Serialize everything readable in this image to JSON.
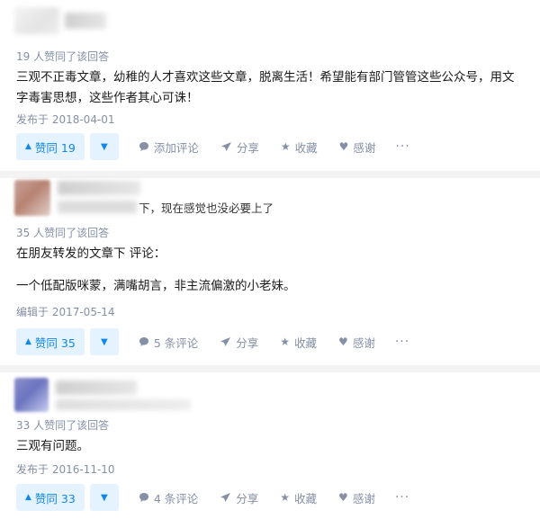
{
  "answers": [
    {
      "author_bio": "",
      "votes_text": "19 人赞同了该回答",
      "content": [
        "三观不正毒文章，幼稚的人才喜欢这些文章，脱离生活！希望能有部门管管这些公众号，用文字毒害思想，这些作者其心可诛！"
      ],
      "date": "发布于 2018-04-01",
      "vote_label": "赞同 19",
      "comment_label": "添加评论",
      "share_label": "分享",
      "collect_label": "收藏",
      "thanks_label": "感谢",
      "more_label": "···"
    },
    {
      "author_bio": "下，现在感觉也没必要上了",
      "votes_text": "35 人赞同了该回答",
      "content": [
        "在朋友转发的文章下 评论：",
        "",
        "一个低配版咪蒙，满嘴胡言，非主流偏激的小老妹。"
      ],
      "date": "编辑于 2017-05-14",
      "vote_label": "赞同 35",
      "comment_label": "5 条评论",
      "share_label": "分享",
      "collect_label": "收藏",
      "thanks_label": "感谢",
      "more_label": "···"
    },
    {
      "author_bio": "",
      "votes_text": "33 人赞同了该回答",
      "content": [
        "三观有问题。"
      ],
      "date": "发布于 2016-11-10",
      "vote_label": "赞同 33",
      "comment_label": "4 条评论",
      "share_label": "分享",
      "collect_label": "收藏",
      "thanks_label": "感谢",
      "more_label": "···"
    }
  ],
  "icons": {
    "upvote": "up-triangle",
    "downvote": "down-triangle",
    "comment": "speech-bubble",
    "share": "paper-plane",
    "collect": "star",
    "thanks": "heart",
    "more": "ellipsis"
  },
  "colors": {
    "accent": "#0f88eb",
    "vote_bg": "#e5f2ff",
    "muted": "#8590a6"
  }
}
